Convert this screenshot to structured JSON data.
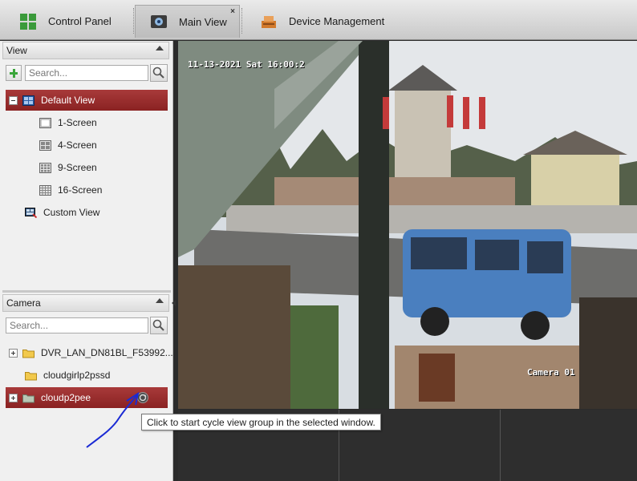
{
  "tabs": [
    {
      "label": "Control Panel",
      "icon": "control-panel-icon"
    },
    {
      "label": "Main View",
      "icon": "camera-view-icon",
      "close": "×"
    },
    {
      "label": "Device Management",
      "icon": "device-management-icon"
    }
  ],
  "view_panel": {
    "title": "View",
    "search_placeholder": "Search...",
    "items": [
      {
        "label": "Default View",
        "icon": "monitor-grid-icon"
      },
      {
        "label": "1-Screen",
        "icon": "one-screen-icon"
      },
      {
        "label": "4-Screen",
        "icon": "four-screen-icon"
      },
      {
        "label": "9-Screen",
        "icon": "nine-screen-icon"
      },
      {
        "label": "16-Screen",
        "icon": "sixteen-screen-icon"
      },
      {
        "label": "Custom View",
        "icon": "custom-view-icon"
      }
    ]
  },
  "camera_panel": {
    "title": "Camera",
    "search_placeholder": "Search...",
    "items": [
      {
        "label": "DVR_LAN_DN81BL_F53992...",
        "icon": "folder-icon"
      },
      {
        "label": "cloudgirlp2pssd",
        "icon": "folder-icon"
      },
      {
        "label": "cloudp2pee",
        "icon": "folder-icon"
      }
    ]
  },
  "video": {
    "timestamp": "11-13-2021 Sat 16:00:2",
    "camera_label": "Camera 01"
  },
  "tooltip": "Click to start cycle view group in the selected window.",
  "colors": {
    "selection": "#9a2d2d",
    "annotation": "#1a2ad4",
    "folder": "#f2c94c"
  }
}
